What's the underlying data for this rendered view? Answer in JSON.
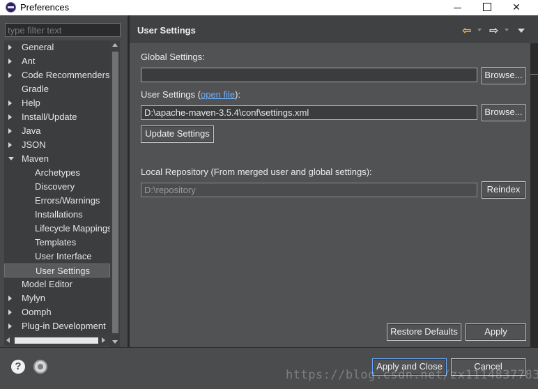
{
  "window": {
    "title": "Preferences"
  },
  "sidebar": {
    "filter_placeholder": "type filter text",
    "items": [
      {
        "label": "General",
        "arrow": "collapsed",
        "level": 0
      },
      {
        "label": "Ant",
        "arrow": "collapsed",
        "level": 0
      },
      {
        "label": "Code Recommenders",
        "arrow": "collapsed",
        "level": 0
      },
      {
        "label": "Gradle",
        "arrow": "none",
        "level": 0
      },
      {
        "label": "Help",
        "arrow": "collapsed",
        "level": 0
      },
      {
        "label": "Install/Update",
        "arrow": "collapsed",
        "level": 0
      },
      {
        "label": "Java",
        "arrow": "collapsed",
        "level": 0
      },
      {
        "label": "JSON",
        "arrow": "collapsed",
        "level": 0
      },
      {
        "label": "Maven",
        "arrow": "expanded",
        "level": 0
      },
      {
        "label": "Archetypes",
        "arrow": "none",
        "level": 1
      },
      {
        "label": "Discovery",
        "arrow": "none",
        "level": 1
      },
      {
        "label": "Errors/Warnings",
        "arrow": "none",
        "level": 1
      },
      {
        "label": "Installations",
        "arrow": "none",
        "level": 1
      },
      {
        "label": "Lifecycle Mappings",
        "arrow": "none",
        "level": 1
      },
      {
        "label": "Templates",
        "arrow": "none",
        "level": 1
      },
      {
        "label": "User Interface",
        "arrow": "none",
        "level": 1
      },
      {
        "label": "User Settings",
        "arrow": "none",
        "level": 1,
        "selected": true
      },
      {
        "label": "Model Editor",
        "arrow": "none",
        "level": 0
      },
      {
        "label": "Mylyn",
        "arrow": "collapsed",
        "level": 0
      },
      {
        "label": "Oomph",
        "arrow": "collapsed",
        "level": 0
      },
      {
        "label": "Plug-in Development",
        "arrow": "collapsed",
        "level": 0
      }
    ]
  },
  "page": {
    "title": "User Settings",
    "global_settings_label": "Global Settings:",
    "global_settings_value": "",
    "browse_label": "Browse...",
    "user_settings_label_prefix": "User Settings (",
    "user_settings_link": "open file",
    "user_settings_label_suffix": "):",
    "user_settings_value": "D:\\apache-maven-3.5.4\\conf\\settings.xml",
    "update_settings_label": "Update Settings",
    "local_repo_label": "Local Repository (From merged user and global settings):",
    "local_repo_value": "D:\\repository",
    "reindex_label": "Reindex",
    "restore_defaults_label": "Restore Defaults",
    "apply_label": "Apply"
  },
  "footer": {
    "apply_close_label": "Apply and Close",
    "cancel_label": "Cancel",
    "watermark": "https://blog.csdn.net/zx1114837783"
  },
  "colors": {
    "link": "#6fb0ff",
    "back_arrow": "#f0c04a",
    "default_button_border": "#6aa8ff"
  }
}
